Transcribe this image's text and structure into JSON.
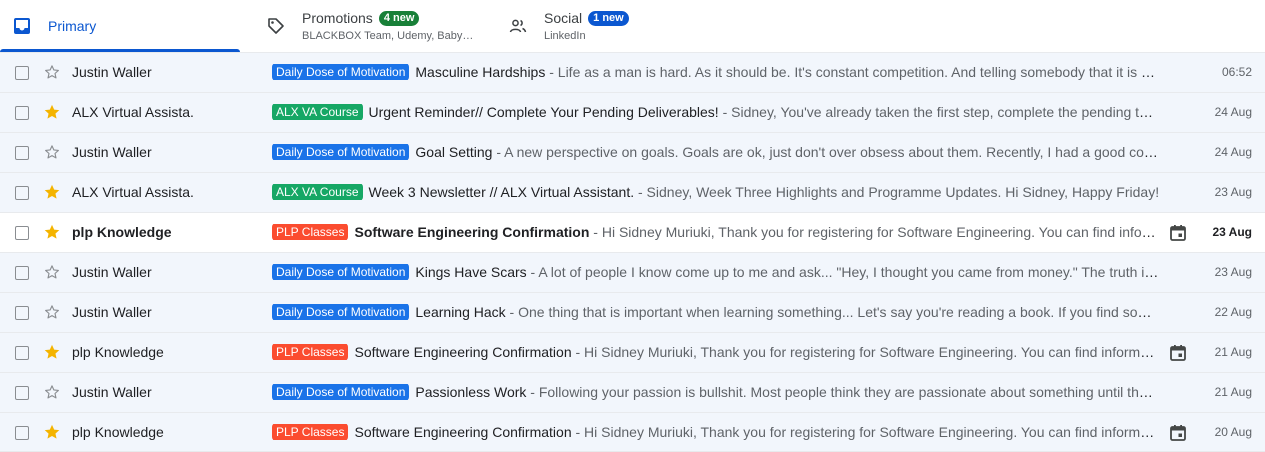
{
  "tabs": {
    "primary": {
      "label": "Primary"
    },
    "promotions": {
      "label": "Promotions",
      "badge": "4 new",
      "badge_color": "#188038",
      "sub": "BLACKBOX Team, Udemy, Baby…"
    },
    "social": {
      "label": "Social",
      "badge": "1 new",
      "badge_color": "#0b57d0",
      "sub": "LinkedIn"
    }
  },
  "colors": {
    "accent": "#0b57d0",
    "star": "#f4b400",
    "label_motivation": "#1a73e8",
    "label_alx": "#16a765",
    "label_plp": "#fb4c2f"
  },
  "emails": [
    {
      "sender": "Justin Waller",
      "starred": false,
      "unread": false,
      "label": "Daily Dose of Motivation",
      "label_color": "#1a73e8",
      "subject": "Masculine Hardships",
      "snippet": " - Life as a man is hard. As it should be. It's constant competition. And telling somebody that it is hard is not complaining.",
      "calendar": false,
      "date": "06:52"
    },
    {
      "sender": "ALX Virtual Assista.",
      "starred": true,
      "unread": false,
      "label": "ALX VA Course",
      "label_color": "#16a765",
      "subject": "Urgent Reminder// Complete Your Pending  Deliverables!",
      "snippet": " - Sidney, You've already taken the first step, complete the pending tasks today.",
      "calendar": false,
      "date": "24 Aug"
    },
    {
      "sender": "Justin Waller",
      "starred": false,
      "unread": false,
      "label": "Daily Dose of Motivation",
      "label_color": "#1a73e8",
      "subject": "Goal Setting",
      "snippet": " - A new perspective on goals. Goals are ok, just don't over obsess about them. Recently, I had a good conversation.",
      "calendar": false,
      "date": "24 Aug"
    },
    {
      "sender": "ALX Virtual Assista.",
      "starred": true,
      "unread": false,
      "label": "ALX VA Course",
      "label_color": "#16a765",
      "subject": "Week 3 Newsletter // ALX Virtual Assistant.",
      "snippet": " - Sidney, Week Three Highlights and Programme Updates. Hi Sidney, Happy Friday!",
      "calendar": false,
      "date": "23 Aug"
    },
    {
      "sender": "plp Knowledge",
      "starred": true,
      "unread": true,
      "label": "PLP Classes",
      "label_color": "#fb4c2f",
      "subject": "Software Engineering Confirmation",
      "snippet": " - Hi Sidney Muriuki, Thank you for registering for Software Engineering. You can find information below.",
      "calendar": true,
      "date": "23 Aug"
    },
    {
      "sender": "Justin Waller",
      "starred": false,
      "unread": false,
      "label": "Daily Dose of Motivation",
      "label_color": "#1a73e8",
      "subject": "Kings Have Scars",
      "snippet": " - A lot of people I know come up to me and ask... \"Hey, I thought you came from money.\" The truth is I didn't.",
      "calendar": false,
      "date": "23 Aug"
    },
    {
      "sender": "Justin Waller",
      "starred": false,
      "unread": false,
      "label": "Daily Dose of Motivation",
      "label_color": "#1a73e8",
      "subject": "Learning Hack",
      "snippet": " - One thing that is important when learning something... Let's say you're reading a book. If you find something useful.",
      "calendar": false,
      "date": "22 Aug"
    },
    {
      "sender": "plp Knowledge",
      "starred": true,
      "unread": false,
      "label": "PLP Classes",
      "label_color": "#fb4c2f",
      "subject": "Software Engineering Confirmation",
      "snippet": " - Hi Sidney Muriuki, Thank you for registering for Software Engineering. You can find information below.",
      "calendar": true,
      "date": "21 Aug"
    },
    {
      "sender": "Justin Waller",
      "starred": false,
      "unread": false,
      "label": "Daily Dose of Motivation",
      "label_color": "#1a73e8",
      "subject": "Passionless Work",
      "snippet": " - Following your passion is bullshit. Most people think they are passionate about something until they try it.",
      "calendar": false,
      "date": "21 Aug"
    },
    {
      "sender": "plp Knowledge",
      "starred": true,
      "unread": false,
      "label": "PLP Classes",
      "label_color": "#fb4c2f",
      "subject": "Software Engineering Confirmation",
      "snippet": " - Hi Sidney Muriuki, Thank you for registering for Software Engineering. You can find information below.",
      "calendar": true,
      "date": "20 Aug"
    }
  ]
}
